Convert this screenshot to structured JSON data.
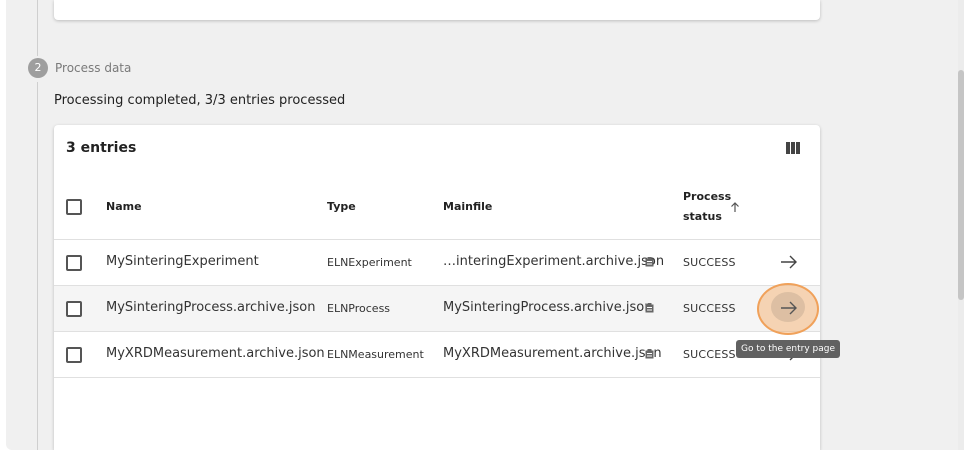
{
  "step": {
    "number": "2",
    "label": "Process data",
    "message": "Processing completed, 3/3 entries processed"
  },
  "table": {
    "title": "3 entries",
    "columns": {
      "name": "Name",
      "type": "Type",
      "mainfile": "Mainfile",
      "status_line1": "Process",
      "status_line2": "status"
    },
    "rows": [
      {
        "name": "MySinteringExperiment",
        "type": "ELNExperiment",
        "mainfile": "…interingExperiment.archive.json",
        "status": "SUCCESS"
      },
      {
        "name": "MySinteringProcess.archive.json",
        "type": "ELNProcess",
        "mainfile": "MySinteringProcess.archive.json",
        "status": "SUCCESS"
      },
      {
        "name": "MyXRDMeasurement.archive.json",
        "type": "ELNMeasurement",
        "mainfile": "MyXRDMeasurement.archive.json",
        "status": "SUCCESS"
      }
    ],
    "sort_icon": "arrow-up-icon",
    "columns_icon": "view-column-icon",
    "row_action_icon": "arrow-right-icon",
    "copy_icon": "clipboard-icon"
  },
  "tooltip": "Go to the entry page",
  "colors": {
    "focus": "#f0a15a",
    "step_circle": "#9e9e9e",
    "tooltip_bg": "#616161"
  }
}
